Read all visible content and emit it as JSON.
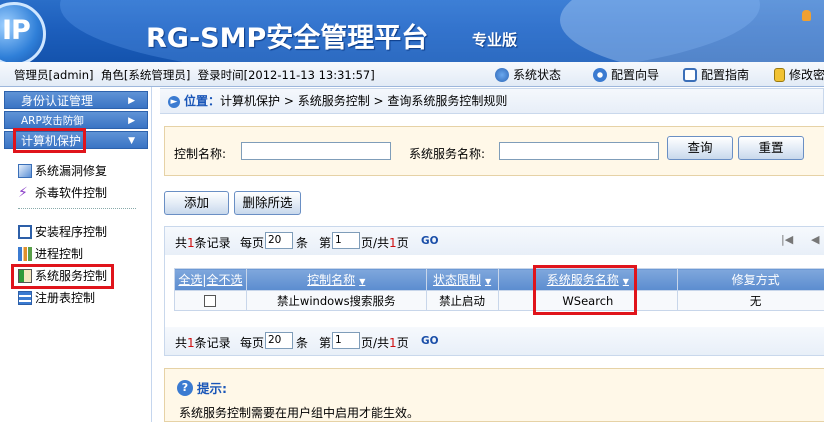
{
  "banner": {
    "logo_text": "IP",
    "title": "RG-SMP安全管理平台",
    "edition": "专业版"
  },
  "statusbar": {
    "admin": "管理员[admin]",
    "role": "角色[系统管理员]",
    "login_time": "登录时间[2012-11-13 13:31:57]",
    "nav": {
      "system_status": "系统状态",
      "config_wizard": "配置向导",
      "config_guide": "配置指南",
      "change_password": "修改密"
    }
  },
  "sidebar": {
    "groups": {
      "identity": "身份认证管理",
      "arp": "ARP攻击防御",
      "computer_protection": "计算机保护"
    },
    "items": {
      "vuln_repair": "系统漏洞修复",
      "antivirus": "杀毒软件控制",
      "install_control": "安装程序控制",
      "process_control": "进程控制",
      "service_control": "系统服务控制",
      "registry_control": "注册表控制"
    }
  },
  "breadcrumb": {
    "location_label": "位置：",
    "path": "计算机保护 > 系统服务控制 > 查询系统服务控制规则"
  },
  "search": {
    "control_name_label": "控制名称:",
    "control_name_value": "",
    "service_name_label": "系统服务名称:",
    "service_name_value": "",
    "query_button": "查询",
    "reset_button": "重置"
  },
  "actions": {
    "add": "添加",
    "delete_selected": "删除所选"
  },
  "pager": {
    "total_prefix": "共",
    "total_count": "1",
    "total_suffix": "条记录",
    "per_page_label": "每页",
    "per_page_value": "20",
    "per_page_unit": "条",
    "page_prefix": "第",
    "page_value": "1",
    "page_mid": "页/共",
    "page_total": "1",
    "page_suffix": "页",
    "go": "GO"
  },
  "table": {
    "headers": {
      "select_all": "全选",
      "select_none": "全不选",
      "control_name": "控制名称",
      "status_limit": "状态限制",
      "service_name": "系统服务名称",
      "repair_method": "修复方式"
    },
    "rows": [
      {
        "control_name": "禁止windows搜索服务",
        "status_limit": "禁止启动",
        "service_name": "WSearch",
        "repair_method": "无"
      }
    ]
  },
  "tip": {
    "title": "提示:",
    "message": "系统服务控制需要在用户组中启用才能生效。"
  },
  "colors": {
    "banner": "#1d5fbd",
    "highlight": "#e0141b",
    "header_blue": "#5b8ccf",
    "search_bg": "#fff8e8"
  }
}
